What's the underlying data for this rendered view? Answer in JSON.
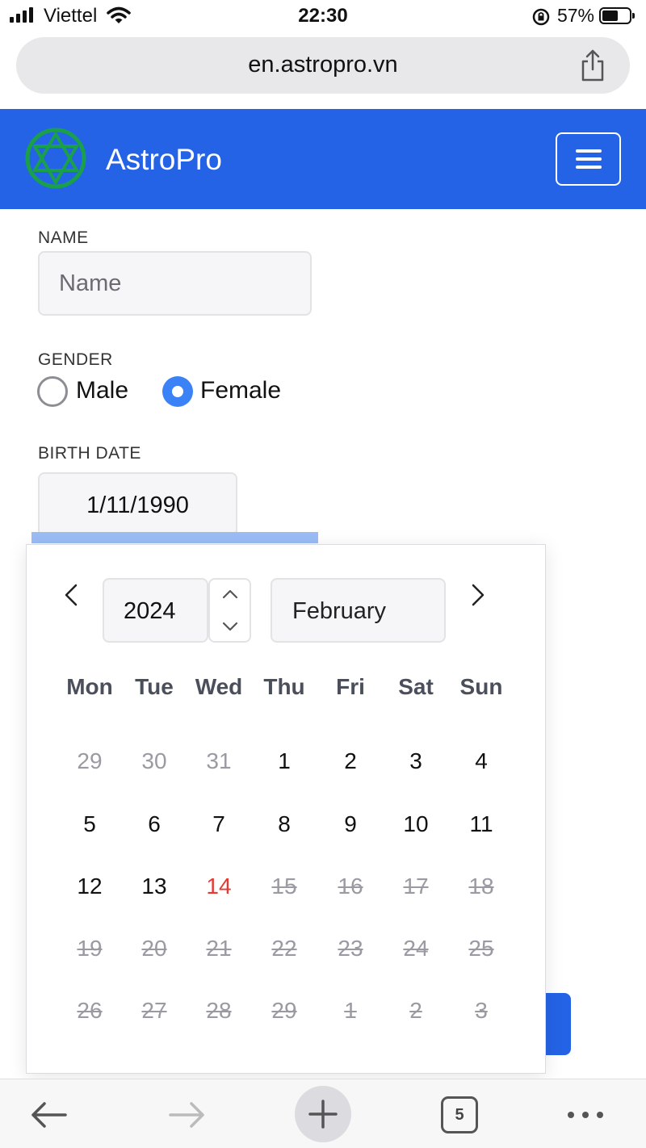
{
  "status_bar": {
    "carrier": "Viettel",
    "time": "22:30",
    "battery": "57%"
  },
  "browser": {
    "url": "en.astropro.vn",
    "tab_count": "5"
  },
  "header": {
    "brand": "AstroPro",
    "colors": {
      "bar": "#2563e6"
    }
  },
  "form": {
    "name": {
      "label": "NAME",
      "placeholder": "Name"
    },
    "gender": {
      "label": "GENDER",
      "options": [
        "Male",
        "Female"
      ],
      "selected": "Female"
    },
    "birth_date": {
      "label": "BIRTH DATE",
      "value": "1/11/1990"
    }
  },
  "calendar": {
    "year": "2024",
    "month": "February",
    "weekdays": [
      "Mon",
      "Tue",
      "Wed",
      "Thu",
      "Fri",
      "Sat",
      "Sun"
    ],
    "weeks": [
      [
        {
          "d": "29",
          "s": "adj"
        },
        {
          "d": "30",
          "s": "adj"
        },
        {
          "d": "31",
          "s": "adj"
        },
        {
          "d": "1",
          "s": "cur"
        },
        {
          "d": "2",
          "s": "cur"
        },
        {
          "d": "3",
          "s": "cur"
        },
        {
          "d": "4",
          "s": "cur"
        }
      ],
      [
        {
          "d": "5",
          "s": "cur"
        },
        {
          "d": "6",
          "s": "cur"
        },
        {
          "d": "7",
          "s": "cur"
        },
        {
          "d": "8",
          "s": "cur"
        },
        {
          "d": "9",
          "s": "cur"
        },
        {
          "d": "10",
          "s": "cur"
        },
        {
          "d": "11",
          "s": "cur"
        }
      ],
      [
        {
          "d": "12",
          "s": "cur"
        },
        {
          "d": "13",
          "s": "cur"
        },
        {
          "d": "14",
          "s": "today"
        },
        {
          "d": "15",
          "s": "dis"
        },
        {
          "d": "16",
          "s": "dis"
        },
        {
          "d": "17",
          "s": "dis"
        },
        {
          "d": "18",
          "s": "dis"
        }
      ],
      [
        {
          "d": "19",
          "s": "dis"
        },
        {
          "d": "20",
          "s": "dis"
        },
        {
          "d": "21",
          "s": "dis"
        },
        {
          "d": "22",
          "s": "dis"
        },
        {
          "d": "23",
          "s": "dis"
        },
        {
          "d": "24",
          "s": "dis"
        },
        {
          "d": "25",
          "s": "dis"
        }
      ],
      [
        {
          "d": "26",
          "s": "dis"
        },
        {
          "d": "27",
          "s": "dis"
        },
        {
          "d": "28",
          "s": "dis"
        },
        {
          "d": "29",
          "s": "dis"
        },
        {
          "d": "1",
          "s": "dis"
        },
        {
          "d": "2",
          "s": "dis"
        },
        {
          "d": "3",
          "s": "dis"
        }
      ]
    ]
  },
  "icons": {
    "signal": "signal-icon",
    "wifi": "wifi-icon",
    "lock_rotation": "orientation-lock-icon",
    "battery": "battery-icon",
    "share": "share-icon",
    "logo": "hexagram-logo-icon",
    "menu": "hamburger-menu-icon",
    "prev": "chevron-left-icon",
    "next": "chevron-right-icon",
    "back": "arrow-left-icon",
    "forward": "arrow-right-icon",
    "add": "plus-icon",
    "tabs": "tabs-icon",
    "more": "more-icon"
  },
  "colors": {
    "accent": "#3b82f6",
    "today": "#e53935",
    "disabled": "#9a9aa2"
  }
}
